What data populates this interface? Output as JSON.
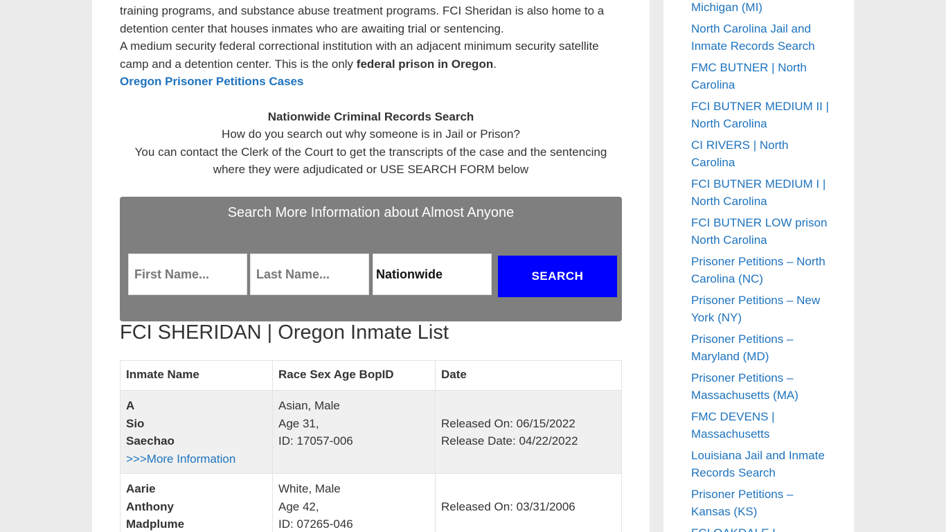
{
  "article": {
    "para1": "training programs, and substance abuse treatment programs. FCI Sheridan is also home to a detention center that houses inmates who are awaiting trial or sentencing.",
    "para2_start": "A medium security federal correctional institution with an adjacent minimum security satellite camp and a detention center. This is the only ",
    "para2_bold": "federal prison in Oregon",
    "para2_end": ".",
    "petitions_link": "Oregon Prisoner Petitions Cases",
    "nationwide_title": "Nationwide Criminal Records Search",
    "nationwide_q": "How do you search out why someone is in Jail or Prison?",
    "nationwide_body": "You can contact the Clerk of the Court to get the transcripts of the case and the sentencing where they were adjudicated or USE SEARCH FORM below"
  },
  "search": {
    "title": "Search More Information about Almost Anyone",
    "first_placeholder": "First Name...",
    "last_placeholder": "Last Name...",
    "location_value": "Nationwide",
    "button": "SEARCH"
  },
  "list": {
    "title": "FCI SHERIDAN | Oregon Inmate List",
    "headers": [
      "Inmate Name",
      "Race Sex Age BopID",
      "Date"
    ],
    "rows": [
      {
        "first": "A",
        "middle": "Sio",
        "last": "Saechao",
        "more": ">>>More Information",
        "race_sex": "Asian, Male",
        "age": "Age 31,",
        "id": "ID: 17057-006",
        "released_on": "Released On: 06/15/2022",
        "release_date": "Release Date: 04/22/2022"
      },
      {
        "first": "Aarie",
        "middle": "Anthony",
        "last": "Madplume",
        "race_sex": "White, Male",
        "age": "Age 42,",
        "id": "ID: 07265-046",
        "released_on": "Released On: 03/31/2006"
      }
    ]
  },
  "sidebar": {
    "items": [
      "Michigan (MI)",
      "North Carolina Jail and Inmate Records Search",
      "FMC BUTNER | North Carolina",
      "FCI BUTNER MEDIUM II | North Carolina",
      "CI RIVERS | North Carolina",
      "FCI BUTNER MEDIUM I | North Carolina",
      "FCI BUTNER LOW prison North Carolina",
      "Prisoner Petitions – North Carolina (NC)",
      "Prisoner Petitions – New York (NY)",
      "Prisoner Petitions – Maryland (MD)",
      "Prisoner Petitions – Massachusetts (MA)",
      "FMC DEVENS | Massachusetts",
      "Louisiana Jail and Inmate Records Search",
      "Prisoner Petitions – Kansas (KS)",
      "FCI OAKDALE I"
    ]
  }
}
